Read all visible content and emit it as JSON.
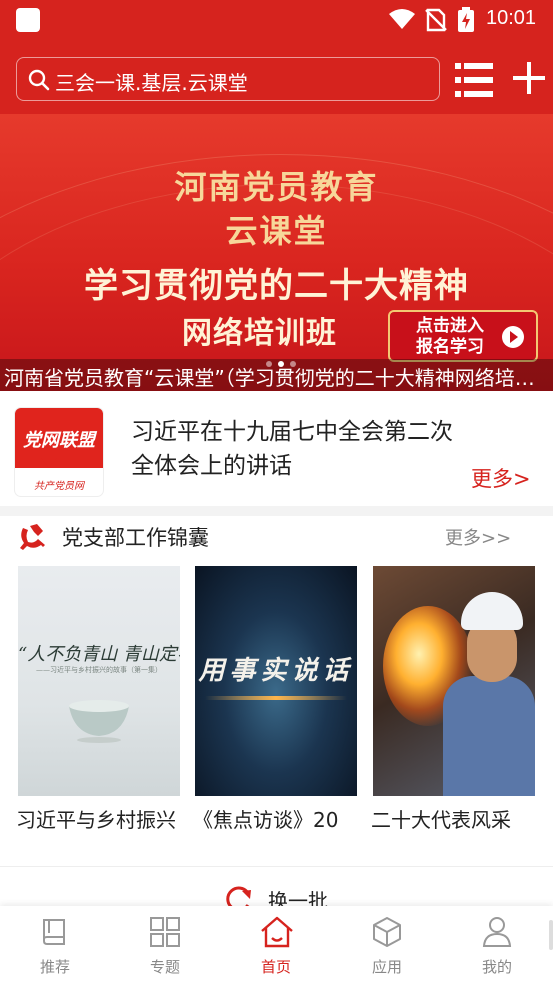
{
  "status_bar": {
    "time": "10:01"
  },
  "search": {
    "placeholder": "三会一课.基层.云课堂"
  },
  "header": {
    "menu_icon": "list-menu-icon",
    "add_icon": "plus-icon"
  },
  "banner": {
    "title_line1": "河南党员教育",
    "title_line2": "云课堂",
    "headline_line1": "学习贯彻党的二十大精神",
    "headline_line2": "网络培训班",
    "cta": "点击进入报名学习",
    "caption": "河南省党员教育“云课堂”（学习贯彻党的二十大精神网络培训班）",
    "slides": 3,
    "active_slide": 1
  },
  "headline": {
    "logo_text": "党网联盟",
    "logo_sub": "共产党员网",
    "title": "习近平在十九届七中全会第二次全体会上的讲话",
    "more": "更多>"
  },
  "section": {
    "icon": "party-emblem-icon",
    "title": "党支部工作锦囊",
    "more": "更多>>",
    "cards": [
      {
        "title": "习近平与乡村振兴",
        "thumb_line1": "“人不负青山 青山定不负人”",
        "thumb_line2": "——习近平与乡村振兴的故事（第一集）"
      },
      {
        "title": "《焦点访谈》20",
        "thumb_line1": "用事实说话"
      },
      {
        "title": "二十大代表风采"
      }
    ]
  },
  "refresh": {
    "label": "换一批"
  },
  "bottom_nav": [
    {
      "label": "推荐",
      "icon": "book-icon",
      "active": false
    },
    {
      "label": "专题",
      "icon": "grid-icon",
      "active": false
    },
    {
      "label": "首页",
      "icon": "home-icon",
      "active": true
    },
    {
      "label": "应用",
      "icon": "cube-icon",
      "active": false
    },
    {
      "label": "我的",
      "icon": "user-icon",
      "active": false
    }
  ],
  "colors": {
    "brand": "#d6231e",
    "muted": "#888888",
    "gold": "#f7d79a"
  }
}
